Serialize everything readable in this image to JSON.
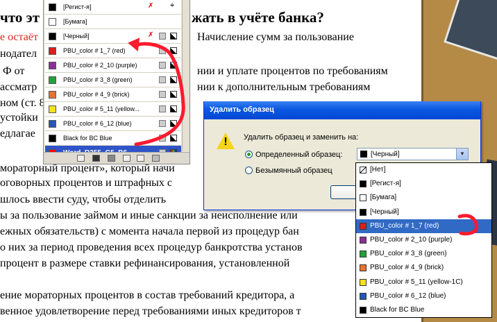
{
  "document": {
    "heading_left": "что эт",
    "heading_right": "жать в учёте банка?",
    "line1_red": "е остаёт",
    "line1_rest": "Начисление сумм за пользование",
    "line2": "нодател",
    "line3_left": "Ф от",
    "line3_right": "нии и уплате процентов по требованиям",
    "line4_left": "ассматр",
    "line4_right": "нии к дополнительным требованиям",
    "line5": "ном (ст. 8",
    "line6": "устойки",
    "line7": "едлагае",
    "line8": "мораторный процент», который начи",
    "line9": "оговорных процентов и штрафных с",
    "line10": "шлось ввести суду, чтобы отделить",
    "line11": "ы за пользование займом и иные санкции за неисполнение или",
    "line12": "ежных обязательств) с момента начала первой из процедур бан",
    "line13": "о них за период проведения всех процедур банкротства установ",
    "line14": "процент в размере ставки рефинансирования, установленной",
    "line15": "ение мораторных процентов в состав требований кредитора, а",
    "line16": "венное удовлетворение перед требованиями иных кредиторов т"
  },
  "swatches_panel": {
    "items": [
      {
        "label": "[Регист-я]",
        "color": "#000000",
        "icons": [
          "no-edit-icon",
          "registration-icon"
        ]
      },
      {
        "label": "[Бумага]",
        "color": "#ffffff",
        "icons": []
      },
      {
        "label": "[Черный]",
        "color": "#000000",
        "icons": [
          "no-edit-icon",
          "spot-icon",
          "cmyk-icon"
        ]
      },
      {
        "label": "PBU_color # 1_7 (red)",
        "color": "#e01b1b",
        "icons": [
          "spot-icon",
          "cmyk-icon"
        ]
      },
      {
        "label": "PBU_color # 2_10 (purple)",
        "color": "#8b2f96",
        "icons": [
          "spot-icon",
          "cmyk-icon"
        ]
      },
      {
        "label": "PBU_color # 3_8 (green)",
        "color": "#23a23a",
        "icons": [
          "spot-icon",
          "cmyk-icon"
        ]
      },
      {
        "label": "PBU_color # 4_9 (brick)",
        "color": "#e67330",
        "icons": [
          "spot-icon",
          "cmyk-icon"
        ]
      },
      {
        "label": "PBU_color # 5_11 (yellow...",
        "color": "#f7e21a",
        "icons": [
          "spot-icon",
          "cmyk-icon"
        ]
      },
      {
        "label": "PBU_color # 6_12 (blue)",
        "color": "#2457b5",
        "icons": [
          "spot-icon",
          "cmyk-icon"
        ]
      },
      {
        "label": "Black for BC Blue",
        "color": "#000000",
        "icons": [
          "spot-icon",
          "cmyk-icon"
        ]
      },
      {
        "label": "Word_R255_G5_B6",
        "color": "#ff0506",
        "icons": [
          "spot-icon",
          "rgb-icon"
        ],
        "selected": true
      }
    ]
  },
  "dialog": {
    "title": "Удалить образец",
    "prompt": "Удалить образец и заменить на:",
    "radio_defined": "Определенный образец:",
    "radio_unnamed": "Безымянный образец",
    "combo_value": "[Черный]",
    "combo_swatch_color": "#000000"
  },
  "dropdown": {
    "items": [
      {
        "label": "[Нет]",
        "color": "none"
      },
      {
        "label": "[Регист-я]",
        "color": "#000000"
      },
      {
        "label": "[Бумага]",
        "color": "#ffffff"
      },
      {
        "label": "[Черный]",
        "color": "#000000"
      },
      {
        "label": "PBU_color # 1_7 (red)",
        "color": "#e01b1b",
        "highlighted": true
      },
      {
        "label": "PBU_color # 2_10 (purple)",
        "color": "#8b2f96"
      },
      {
        "label": "PBU_color # 3_8 (green)",
        "color": "#23a23a"
      },
      {
        "label": "PBU_color # 4_9 (brick)",
        "color": "#e67330"
      },
      {
        "label": "PBU_color # 5_11 (yellow-1C)",
        "color": "#f7e21a"
      },
      {
        "label": "PBU_color # 6_12 (blue)",
        "color": "#2457b5"
      },
      {
        "label": "Black for BC Blue",
        "color": "#000000"
      }
    ]
  },
  "colors": {
    "annotation_red": "#ff1a2e",
    "selection_blue": "#316ac5"
  }
}
